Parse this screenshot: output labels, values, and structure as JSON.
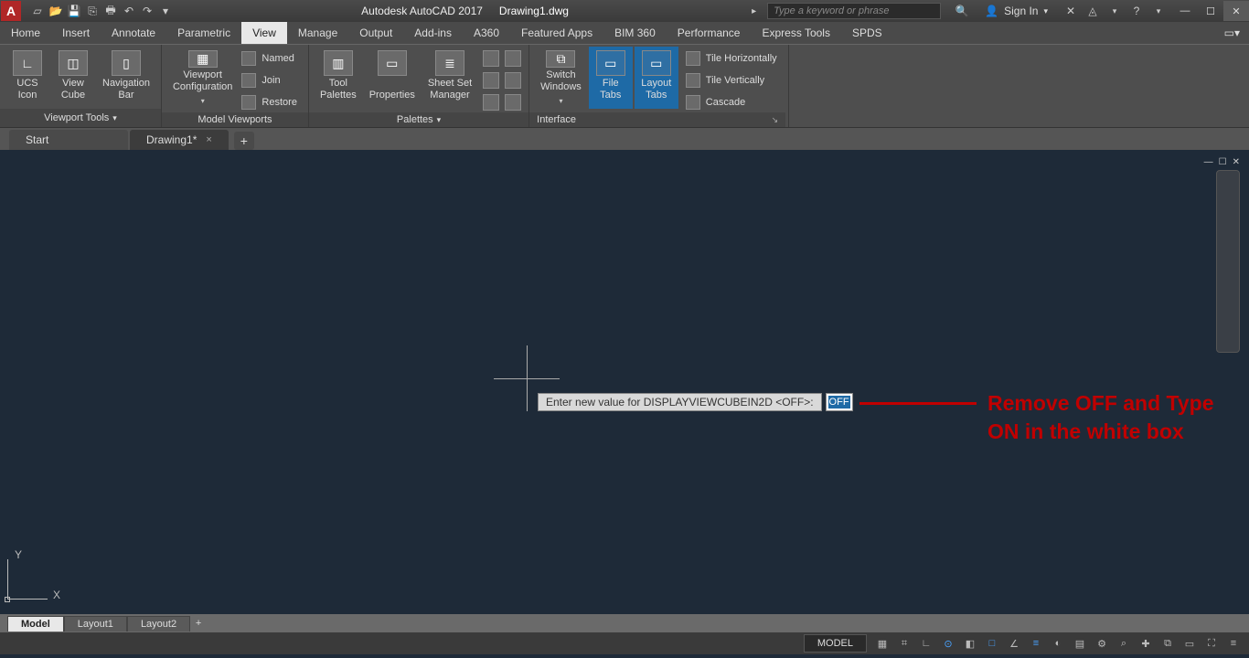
{
  "title": {
    "app": "Autodesk AutoCAD 2017",
    "doc": "Drawing1.dwg"
  },
  "search": {
    "placeholder": "Type a keyword or phrase"
  },
  "signin": {
    "label": "Sign In"
  },
  "menu_tabs": {
    "items": [
      "Home",
      "Insert",
      "Annotate",
      "Parametric",
      "View",
      "Manage",
      "Output",
      "Add-ins",
      "A360",
      "Featured Apps",
      "BIM 360",
      "Performance",
      "Express Tools",
      "SPDS"
    ],
    "active_index": 4
  },
  "ribbon": {
    "viewport_tools": {
      "title": "Viewport Tools",
      "ucs_icon": "UCS\nIcon",
      "view_cube": "View\nCube",
      "nav_bar": "Navigation\nBar"
    },
    "model_viewports": {
      "title": "Model Viewports",
      "viewport_config": "Viewport\nConfiguration",
      "named": "Named",
      "join": "Join",
      "restore": "Restore"
    },
    "palettes": {
      "title": "Palettes",
      "tool_palettes": "Tool\nPalettes",
      "properties": "Properties",
      "sheet_set": "Sheet Set\nManager"
    },
    "interface": {
      "title": "Interface",
      "switch_windows": "Switch\nWindows",
      "file_tabs": "File\nTabs",
      "layout_tabs": "Layout\nTabs",
      "tile_h": "Tile Horizontally",
      "tile_v": "Tile Vertically",
      "cascade": "Cascade"
    }
  },
  "doc_tabs": {
    "start": "Start",
    "drawing": "Drawing1*"
  },
  "dyn_input": {
    "prompt": "Enter new value for DISPLAYVIEWCUBEIN2D <OFF>:",
    "value": "OFF"
  },
  "annotation": {
    "text": "Remove OFF and Type ON in the white box"
  },
  "ucs": {
    "x": "X",
    "y": "Y"
  },
  "layout_tabs": {
    "model": "Model",
    "l1": "Layout1",
    "l2": "Layout2"
  },
  "status": {
    "model": "MODEL"
  }
}
